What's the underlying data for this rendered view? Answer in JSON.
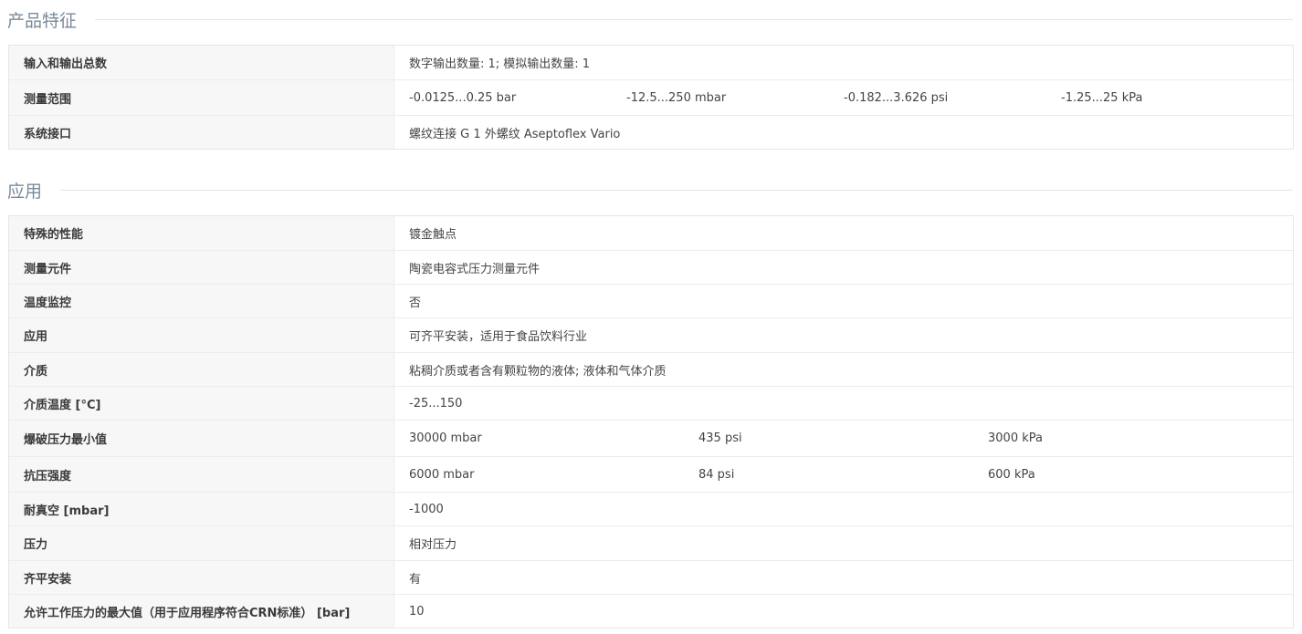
{
  "sections": [
    {
      "title": "产品特征",
      "rows": [
        {
          "label": "输入和输出总数",
          "values": [
            "数字输出数量: 1; 模拟输出数量: 1"
          ]
        },
        {
          "label": "测量范围",
          "values": [
            "-0.0125...0.25 bar",
            "-12.5...250 mbar",
            "-0.182...3.626 psi",
            "-1.25...25 kPa"
          ]
        },
        {
          "label": "系统接口",
          "values": [
            "螺纹连接 G 1 外螺纹 Aseptoflex Vario"
          ]
        }
      ]
    },
    {
      "title": "应用",
      "rows": [
        {
          "label": "特殊的性能",
          "values": [
            "镀金触点"
          ]
        },
        {
          "label": "测量元件",
          "values": [
            "陶瓷电容式压力测量元件"
          ]
        },
        {
          "label": "温度监控",
          "values": [
            "否"
          ]
        },
        {
          "label": "应用",
          "values": [
            "可齐平安装，适用于食品饮料行业"
          ]
        },
        {
          "label": "介质",
          "values": [
            "粘稠介质或者含有颗粒物的液体; 液体和气体介质"
          ]
        },
        {
          "label": "介质温度 [°C]",
          "values": [
            "-25...150"
          ]
        },
        {
          "label": "爆破压力最小值",
          "values": [
            "30000 mbar",
            "435 psi",
            "3000 kPa"
          ]
        },
        {
          "label": "抗压强度",
          "values": [
            "6000 mbar",
            "84 psi",
            "600 kPa"
          ]
        },
        {
          "label": "耐真空 [mbar]",
          "values": [
            "-1000"
          ]
        },
        {
          "label": "压力",
          "values": [
            "相对压力"
          ]
        },
        {
          "label": "齐平安装",
          "values": [
            "有"
          ]
        },
        {
          "label": "允许工作压力的最大值（用于应用程序符合CRN标准） [bar]",
          "values": [
            "10"
          ]
        }
      ]
    }
  ]
}
